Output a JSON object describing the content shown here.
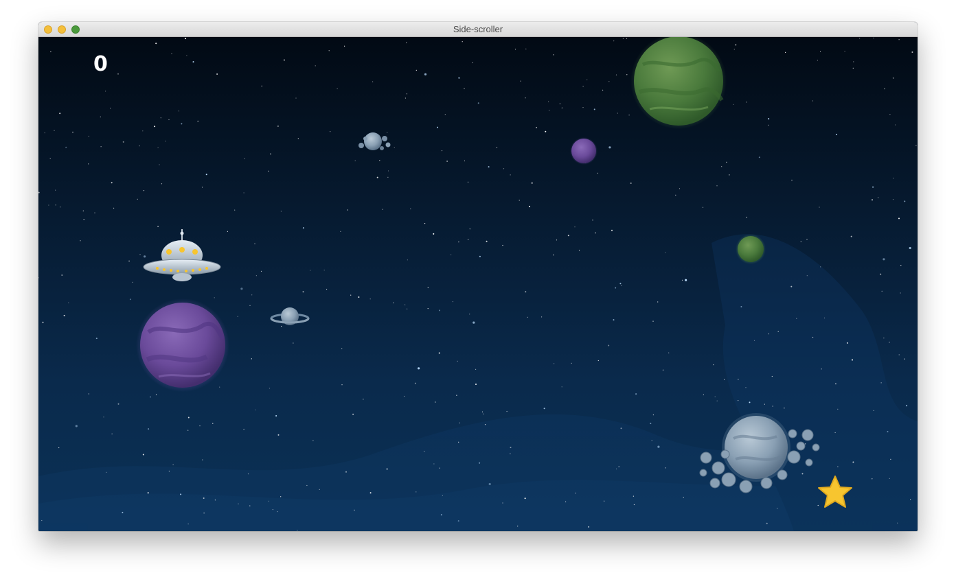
{
  "window": {
    "title": "Side-scroller",
    "controls": [
      "close",
      "minimize",
      "zoom"
    ]
  },
  "hud": {
    "score": "0"
  },
  "scene": {
    "background": "deep-space-starfield",
    "player": "ufo-spaceship",
    "objects": [
      "green-planet",
      "purple-planet",
      "small-purple-planet",
      "small-green-planet",
      "ringed-planet",
      "asteroid-cluster",
      "small-asteroid-cluster",
      "grey-planet-with-asteroids",
      "gold-star"
    ]
  },
  "colors": {
    "space_top": "#020a14",
    "space_bottom": "#0b3156",
    "green_planet": "#4a7a3c",
    "purple_planet": "#6a4a9a",
    "star": "#f7c52f"
  }
}
